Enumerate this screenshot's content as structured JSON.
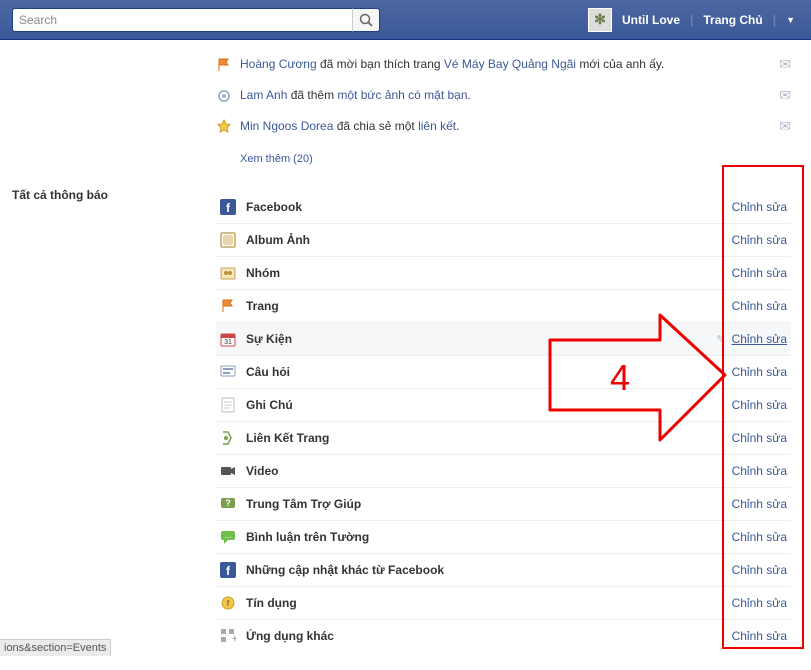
{
  "topbar": {
    "search_placeholder": "Search",
    "user_name": "Until Love",
    "home_label": "Trang Chủ"
  },
  "notifications": [
    {
      "actor": "Hoàng Cương",
      "mid1": " đã mời bạn thích trang ",
      "target": "Vé Máy Bay Quảng Ngãi",
      "mid2": " mới của anh ấy.",
      "icon": "flag"
    },
    {
      "actor": "Lam Anh",
      "mid1": " đã thêm ",
      "target": "một bức ảnh có mặt bạn",
      "mid2": ".",
      "icon": "gear"
    },
    {
      "actor": "Min Ngoos Dorea",
      "mid1": " đã chia sẻ một ",
      "target": "liên kết",
      "mid2": ".",
      "icon": "star"
    }
  ],
  "see_more_label": "Xem thêm (20)",
  "section_title": "Tất cả thông báo",
  "edit_label": "Chỉnh sửa",
  "settings": [
    {
      "title": "Facebook",
      "icon": "fb"
    },
    {
      "title": "Album Ảnh",
      "icon": "photo"
    },
    {
      "title": "Nhóm",
      "icon": "group"
    },
    {
      "title": "Trang",
      "icon": "flag"
    },
    {
      "title": "Sự Kiện",
      "icon": "cal",
      "hover": true
    },
    {
      "title": "Câu hỏi",
      "icon": "question"
    },
    {
      "title": "Ghi Chú",
      "icon": "note"
    },
    {
      "title": "Liên Kết Trang",
      "icon": "link"
    },
    {
      "title": "Video",
      "icon": "video"
    },
    {
      "title": "Trung Tâm Trợ Giúp",
      "icon": "help"
    },
    {
      "title": "Bình luận trên Tường",
      "icon": "comment"
    },
    {
      "title": "Những cập nhật khác từ Facebook",
      "icon": "fb"
    },
    {
      "title": "Tín dụng",
      "icon": "credit"
    },
    {
      "title": "Ứng dụng khác",
      "icon": "apps"
    }
  ],
  "status_bar_text": "ions&section=Events",
  "annotation": {
    "number": "4"
  }
}
